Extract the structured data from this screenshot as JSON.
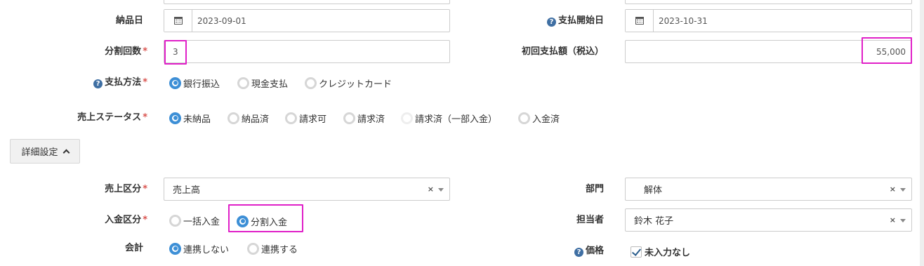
{
  "delivery_date": {
    "label": "納品日",
    "value": "2023-09-01",
    "icon": "calendar-icon"
  },
  "payment_start_date": {
    "label": "支払開始日",
    "value": "2023-10-31",
    "icon": "calendar-icon",
    "help": "?"
  },
  "installments": {
    "label": "分割回数",
    "required": "*",
    "value": "3"
  },
  "first_payment": {
    "label": "初回支払額（税込）",
    "value": "55,000"
  },
  "payment_method": {
    "label": "支払方法",
    "required": "*",
    "help": "?",
    "options": [
      "銀行振込",
      "現金支払",
      "クレジットカード"
    ],
    "selected": "銀行振込"
  },
  "sales_status": {
    "label": "売上ステータス",
    "required": "*",
    "options": [
      "未納品",
      "納品済",
      "請求可",
      "請求済",
      "請求済（一部入金）",
      "入金済"
    ],
    "selected": "未納品"
  },
  "detail_settings": {
    "label": "詳細設定",
    "icon": "chevron-up-icon"
  },
  "sales_category": {
    "label": "売上区分",
    "required": "*",
    "value": "売上高",
    "clear": "×"
  },
  "department": {
    "label": "部門",
    "value": "解体",
    "clear": "×"
  },
  "deposit_type": {
    "label": "入金区分",
    "required": "*",
    "options": [
      "一括入金",
      "分割入金"
    ],
    "selected": "分割入金"
  },
  "staff": {
    "label": "担当者",
    "value": "鈴木 花子",
    "clear": "×"
  },
  "accounting": {
    "label": "会計",
    "options": [
      "連携しない",
      "連携する"
    ],
    "selected": "連携しない"
  },
  "price": {
    "label": "価格",
    "help": "?",
    "checkbox_label": "未入力なし",
    "checked": true
  },
  "colors": {
    "accent": "#3d8fd6",
    "highlight": "#e020c8",
    "required": "#d9534f"
  }
}
